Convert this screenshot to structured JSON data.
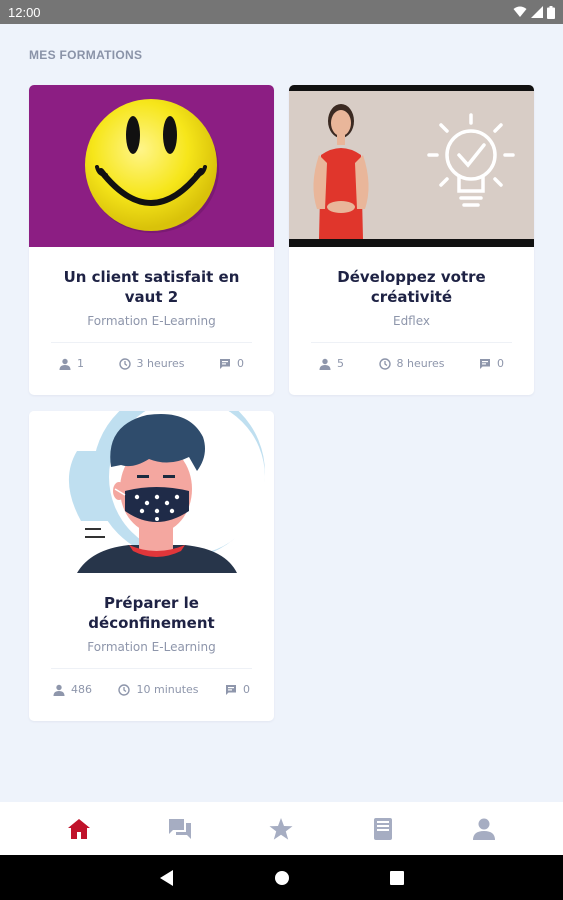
{
  "status_bar": {
    "time": "12:00"
  },
  "section_title": "MES FORMATIONS",
  "courses": [
    {
      "title": "Un client satisfait en vaut 2",
      "subtitle": "Formation E-Learning",
      "learners": "1",
      "duration": "3 heures",
      "comments": "0",
      "image": "smiley-face"
    },
    {
      "title": "Développez votre créativité",
      "subtitle": "Edflex",
      "learners": "5",
      "duration": "8 heures",
      "comments": "0",
      "image": "woman-lightbulb"
    },
    {
      "title": "Préparer le déconfinement",
      "subtitle": "Formation E-Learning",
      "learners": "486",
      "duration": "10 minutes",
      "comments": "0",
      "image": "masked-man"
    }
  ],
  "bottom_nav": [
    {
      "icon": "home-icon",
      "active": true
    },
    {
      "icon": "chat-icon",
      "active": false
    },
    {
      "icon": "star-icon",
      "active": false
    },
    {
      "icon": "book-icon",
      "active": false
    },
    {
      "icon": "profile-icon",
      "active": false
    }
  ],
  "colors": {
    "accent": "#c0122a",
    "inactive": "#a6adc2",
    "title": "#1e2244",
    "muted": "#8e96ab"
  }
}
